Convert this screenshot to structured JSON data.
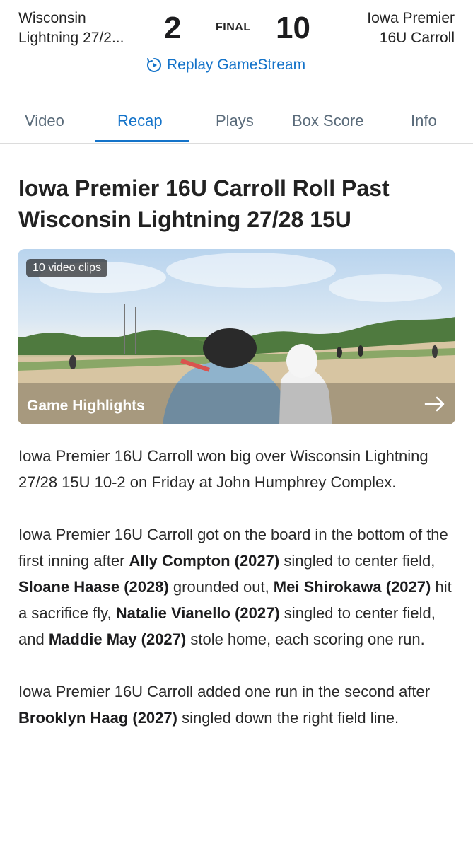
{
  "scoreboard": {
    "away_team_line1": "Wisconsin",
    "away_team_line2": "Lightning 27/2...",
    "away_score": "2",
    "status": "FINAL",
    "home_score": "10",
    "home_team_line1": "Iowa Premier",
    "home_team_line2": "16U Carroll",
    "replay_label": "Replay GameStream"
  },
  "tabs": [
    {
      "label": "Video"
    },
    {
      "label": "Recap"
    },
    {
      "label": "Plays"
    },
    {
      "label": "Box Score"
    },
    {
      "label": "Info"
    }
  ],
  "active_tab": "Recap",
  "article": {
    "headline": "Iowa Premier 16U Carroll Roll Past Wisconsin Lightning 27/28 15U",
    "video": {
      "clips_badge": "10 video clips",
      "title": "Game Highlights"
    },
    "p1": "Iowa Premier 16U Carroll won big over Wisconsin Lightning 27/28 15U 10-2 on Friday at John Humphrey Complex.",
    "p2": {
      "t1": "Iowa Premier 16U Carroll got on the board in the bottom of the first inning after ",
      "n1": "Ally Compton (2027)",
      "t2": " singled to center field, ",
      "n2": "Sloane Haase (2028)",
      "t3": " grounded out, ",
      "n3": "Mei Shirokawa (2027)",
      "t4": " hit a sacrifice fly, ",
      "n4": "Natalie Vianello (2027)",
      "t5": " singled to center field, and ",
      "n5": "Maddie May (2027)",
      "t6": " stole home, each scoring one run."
    },
    "p3": {
      "t1": "Iowa Premier 16U Carroll added one run in the second after ",
      "n1": "Brooklyn Haag (2027)",
      "t2": " singled down the right field line."
    }
  },
  "colors": {
    "accent": "#1473c9",
    "tab_inactive": "#5a6b7a"
  },
  "icons": {
    "replay": "replay-clock-icon",
    "media_arrow": "arrow-right-icon"
  }
}
